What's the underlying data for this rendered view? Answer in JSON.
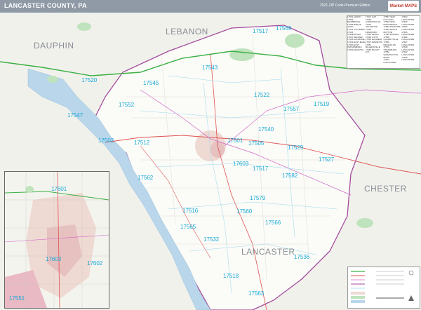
{
  "header": {
    "title": "LANCASTER COUNTY, PA",
    "subtitle": "2021 ZIP Code Premium Edition",
    "logo": "Market MAPS"
  },
  "counties": [
    {
      "name": "LEBANON"
    },
    {
      "name": "DAUPHIN"
    },
    {
      "name": "CHESTER"
    },
    {
      "name": "LANCASTER"
    }
  ],
  "zip_codes": [
    "17517",
    "17569",
    "17543",
    "17522",
    "17545",
    "17557",
    "17519",
    "17520",
    "17552",
    "17540",
    "17502",
    "17547",
    "17601",
    "17505",
    "17529",
    "17512",
    "17603",
    "17527",
    "17582",
    "17517",
    "17562",
    "17579",
    "17566",
    "17516",
    "17560",
    "17565",
    "17532",
    "17536",
    "17518",
    "17563",
    "17601",
    "17603",
    "17551",
    "17602",
    "17501"
  ],
  "colors": {
    "header": "#8f9aa6",
    "zip_label": "#19a9d9",
    "water": "#b9d6ea",
    "county_border": "#a34d9e",
    "highway_green": "#3cb043",
    "road_red": "#e05252",
    "park_green": "#bfe3bd"
  }
}
